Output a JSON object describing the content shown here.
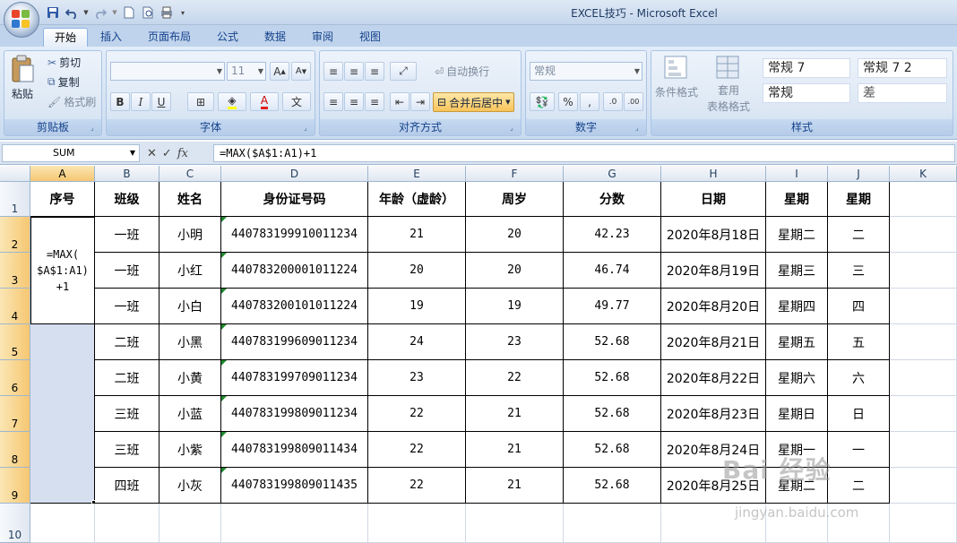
{
  "window": {
    "title": "EXCEL技巧 - Microsoft Excel"
  },
  "tabs": [
    {
      "label": "开始",
      "active": true
    },
    {
      "label": "插入"
    },
    {
      "label": "页面布局"
    },
    {
      "label": "公式"
    },
    {
      "label": "数据"
    },
    {
      "label": "审阅"
    },
    {
      "label": "视图"
    }
  ],
  "ribbon": {
    "clipboard": {
      "paste": "粘贴",
      "cut": "剪切",
      "copy": "复制",
      "format_painter": "格式刷",
      "label": "剪贴板"
    },
    "font": {
      "font_name": "",
      "font_size": "11",
      "grow": "A",
      "shrink": "A",
      "bold": "B",
      "italic": "I",
      "underline": "U",
      "font_color": "A",
      "phonetic": "文",
      "label": "字体"
    },
    "alignment": {
      "wrap_text": "自动换行",
      "merge_center": "合并后居中",
      "label": "对齐方式"
    },
    "number": {
      "format": "常规",
      "percent": "%",
      "comma": ",",
      "inc_decimal": ".0",
      "dec_decimal": ".00",
      "label": "数字"
    },
    "styles": {
      "conditional": "条件格式",
      "table_format_1": "套用",
      "table_format_2": "表格格式",
      "gallery": [
        "常规 7",
        "常规 7 2",
        "常规",
        "差"
      ],
      "label": "样式"
    }
  },
  "formula_bar": {
    "name_box": "SUM",
    "cancel": "✕",
    "enter": "✓",
    "fx": "fx",
    "formula": "=MAX($A$1:A1)+1"
  },
  "sheet": {
    "columns": [
      "A",
      "B",
      "C",
      "D",
      "E",
      "F",
      "G",
      "H",
      "I",
      "J",
      "K"
    ],
    "rows": [
      "1",
      "2",
      "3",
      "4",
      "5",
      "6",
      "7",
      "8",
      "9",
      "10"
    ],
    "headers": [
      "序号",
      "班级",
      "姓名",
      "身份证号码",
      "年龄（虚龄）",
      "周岁",
      "分数",
      "日期",
      "星期",
      "星期"
    ],
    "editing_cell": "=MAX(\n$A$1:A1)\n+1",
    "data": [
      [
        "一班",
        "小明",
        "440783199910011234",
        "21",
        "20",
        "42.23",
        "2020年8月18日",
        "星期二",
        "二"
      ],
      [
        "一班",
        "小红",
        "440783200001011224",
        "20",
        "20",
        "46.74",
        "2020年8月19日",
        "星期三",
        "三"
      ],
      [
        "一班",
        "小白",
        "440783200101011224",
        "19",
        "19",
        "49.77",
        "2020年8月20日",
        "星期四",
        "四"
      ],
      [
        "二班",
        "小黑",
        "440783199609011234",
        "24",
        "23",
        "52.68",
        "2020年8月21日",
        "星期五",
        "五"
      ],
      [
        "二班",
        "小黄",
        "440783199709011234",
        "23",
        "22",
        "52.68",
        "2020年8月22日",
        "星期六",
        "六"
      ],
      [
        "三班",
        "小蓝",
        "440783199809011234",
        "22",
        "21",
        "52.68",
        "2020年8月23日",
        "星期日",
        "日"
      ],
      [
        "三班",
        "小紫",
        "440783199809011434",
        "22",
        "21",
        "52.68",
        "2020年8月24日",
        "星期一",
        "一"
      ],
      [
        "四班",
        "小灰",
        "440783199809011435",
        "22",
        "21",
        "52.68",
        "2020年8月25日",
        "星期二",
        "二"
      ]
    ]
  },
  "watermark": {
    "main": "Bai 经验",
    "sub": "jingyan.baidu.com"
  }
}
